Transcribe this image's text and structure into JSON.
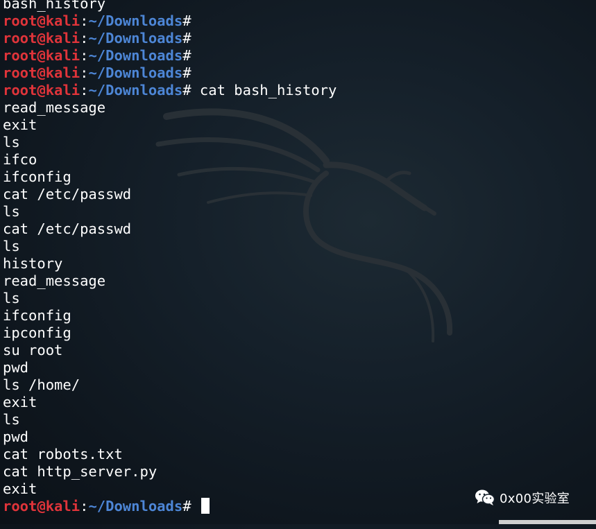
{
  "prompt": {
    "user_host": "root@kali",
    "separator": ":",
    "path": "~/Downloads",
    "symbol": "#"
  },
  "terminal": {
    "top_partial_line": "bash_history",
    "empty_prompt_count": 4,
    "command": " cat bash_history",
    "history_output": [
      "read_message",
      "exit",
      "ls",
      "ifco",
      "ifconfig",
      "cat /etc/passwd",
      "ls",
      "cat /etc/passwd",
      "ls",
      "history",
      "read_message",
      "ls",
      "ifconfig",
      "ipconfig",
      "su root",
      "pwd",
      "ls /home/",
      "exit",
      "ls",
      "pwd",
      "cat robots.txt",
      "cat http_server.py",
      "exit"
    ]
  },
  "watermark": {
    "icon": "wechat-icon",
    "text": "0x00实验室"
  },
  "colors": {
    "user": "#e0343a",
    "path": "#4d86d6",
    "text": "#ffffff",
    "background": "#15202a"
  }
}
